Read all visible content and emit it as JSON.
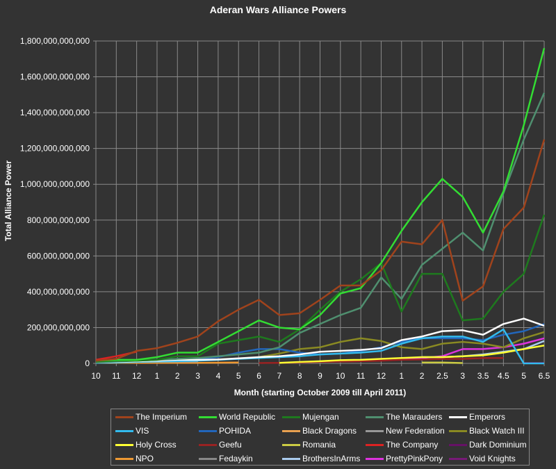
{
  "chart_data": {
    "type": "line",
    "title": "Aderan Wars Alliance Powers",
    "xlabel": "Month (starting October 2009 till April 2011)",
    "ylabel": "Total Alliance Power",
    "ylim": [
      0,
      1800000000000
    ],
    "yticks": [
      0,
      200000000000,
      400000000000,
      600000000000,
      800000000000,
      1000000000000,
      1200000000000,
      1400000000000,
      1600000000000,
      1800000000000
    ],
    "ytick_labels": [
      "0",
      "200,000,000,000",
      "400,000,000,000",
      "600,000,000,000",
      "800,000,000,000",
      "1,000,000,000,000",
      "1,200,000,000,000",
      "1,400,000,000,000",
      "1,600,000,000,000",
      "1,800,000,000,000"
    ],
    "categories": [
      "10",
      "11",
      "12",
      "1",
      "2",
      "3",
      "4",
      "5",
      "6",
      "7",
      "8",
      "9",
      "10",
      "11",
      "12",
      "1",
      "2",
      "2.5",
      "3",
      "3.5",
      "4.5",
      "5",
      "6.5"
    ],
    "grid": true,
    "legend_position": "bottom",
    "series": [
      {
        "name": "The Imperium",
        "color": "#a0431c",
        "values": [
          15000000000,
          25000000000,
          70000000000,
          85000000000,
          115000000000,
          150000000000,
          235000000000,
          300000000000,
          355000000000,
          270000000000,
          280000000000,
          355000000000,
          435000000000,
          435000000000,
          520000000000,
          680000000000,
          665000000000,
          800000000000,
          350000000000,
          430000000000,
          750000000000,
          870000000000,
          1250000000000
        ]
      },
      {
        "name": "World Republic",
        "color": "#33dd33",
        "values": [
          15000000000,
          20000000000,
          20000000000,
          35000000000,
          60000000000,
          60000000000,
          120000000000,
          180000000000,
          240000000000,
          200000000000,
          190000000000,
          270000000000,
          390000000000,
          420000000000,
          560000000000,
          740000000000,
          900000000000,
          1030000000000,
          930000000000,
          730000000000,
          960000000000,
          1330000000000,
          1760000000000
        ]
      },
      {
        "name": "Mujengan",
        "color": "#1e7a1e",
        "values": [
          10000000000,
          15000000000,
          15000000000,
          20000000000,
          40000000000,
          40000000000,
          110000000000,
          130000000000,
          150000000000,
          120000000000,
          190000000000,
          300000000000,
          400000000000,
          470000000000,
          560000000000,
          290000000000,
          500000000000,
          500000000000,
          240000000000,
          250000000000,
          400000000000,
          500000000000,
          830000000000
        ]
      },
      {
        "name": "The Marauders",
        "color": "#4f8f6f",
        "values": [
          5000000000,
          10000000000,
          15000000000,
          20000000000,
          25000000000,
          30000000000,
          40000000000,
          50000000000,
          60000000000,
          90000000000,
          170000000000,
          220000000000,
          270000000000,
          310000000000,
          480000000000,
          360000000000,
          550000000000,
          640000000000,
          730000000000,
          630000000000,
          950000000000,
          1250000000000,
          1510000000000
        ]
      },
      {
        "name": "Emperors",
        "color": "#ffffff",
        "values": [
          5000000000,
          8000000000,
          12000000000,
          15000000000,
          20000000000,
          20000000000,
          22000000000,
          28000000000,
          35000000000,
          40000000000,
          50000000000,
          65000000000,
          70000000000,
          75000000000,
          85000000000,
          130000000000,
          150000000000,
          180000000000,
          185000000000,
          160000000000,
          220000000000,
          250000000000,
          210000000000
        ]
      },
      {
        "name": "VIS",
        "color": "#33bbee",
        "values": [
          3000000000,
          5000000000,
          8000000000,
          10000000000,
          12000000000,
          15000000000,
          20000000000,
          25000000000,
          30000000000,
          35000000000,
          40000000000,
          50000000000,
          55000000000,
          60000000000,
          70000000000,
          110000000000,
          140000000000,
          150000000000,
          150000000000,
          120000000000,
          190000000000,
          0,
          0
        ]
      },
      {
        "name": "POHIDA",
        "color": "#2266bb",
        "values": [
          3000000000,
          8000000000,
          15000000000,
          20000000000,
          25000000000,
          25000000000,
          35000000000,
          60000000000,
          80000000000,
          80000000000,
          60000000000,
          50000000000,
          55000000000,
          70000000000,
          90000000000,
          120000000000,
          140000000000,
          140000000000,
          140000000000,
          130000000000,
          160000000000,
          180000000000,
          220000000000
        ]
      },
      {
        "name": "Black Dragons",
        "color": "#e8a050",
        "values": [
          null,
          null,
          null,
          null,
          null,
          null,
          null,
          null,
          null,
          null,
          null,
          null,
          null,
          null,
          null,
          null,
          null,
          null,
          null,
          null,
          null,
          null,
          null
        ]
      },
      {
        "name": "New Federation",
        "color": "#999999",
        "values": [
          8000000000,
          10000000000,
          10000000000,
          10000000000,
          10000000000,
          10000000000,
          null,
          null,
          null,
          null,
          null,
          null,
          null,
          null,
          null,
          null,
          null,
          null,
          null,
          null,
          null,
          null,
          null
        ]
      },
      {
        "name": "Black Watch III",
        "color": "#8a8a22",
        "values": [
          null,
          null,
          null,
          null,
          null,
          null,
          null,
          null,
          35000000000,
          55000000000,
          80000000000,
          90000000000,
          120000000000,
          140000000000,
          125000000000,
          90000000000,
          80000000000,
          110000000000,
          120000000000,
          110000000000,
          90000000000,
          140000000000,
          175000000000
        ]
      },
      {
        "name": "Holy Cross",
        "color": "#ffff33",
        "values": [
          null,
          null,
          null,
          null,
          null,
          null,
          null,
          null,
          null,
          3000000000,
          8000000000,
          12000000000,
          18000000000,
          20000000000,
          25000000000,
          30000000000,
          35000000000,
          35000000000,
          40000000000,
          45000000000,
          60000000000,
          80000000000,
          100000000000
        ]
      },
      {
        "name": "Geefu",
        "color": "#992222",
        "values": [
          null,
          null,
          null,
          null,
          null,
          null,
          null,
          null,
          2000000000,
          3000000000,
          5000000000,
          8000000000,
          10000000000,
          12000000000,
          15000000000,
          20000000000,
          22000000000,
          25000000000,
          25000000000,
          30000000000,
          30000000000,
          null,
          null
        ]
      },
      {
        "name": "Romania",
        "color": "#cccc44",
        "values": [
          null,
          null,
          null,
          null,
          null,
          null,
          null,
          null,
          null,
          null,
          null,
          null,
          null,
          null,
          null,
          null,
          5000000000,
          5000000000,
          2000000000,
          null,
          null,
          null,
          null
        ]
      },
      {
        "name": "The Company",
        "color": "#dd2222",
        "values": [
          20000000000,
          40000000000,
          65000000000,
          null,
          null,
          null,
          null,
          null,
          null,
          null,
          null,
          null,
          null,
          null,
          null,
          null,
          null,
          null,
          null,
          null,
          null,
          null,
          null
        ]
      },
      {
        "name": "Dark Dominium",
        "color": "#661166",
        "values": [
          null,
          null,
          null,
          null,
          null,
          null,
          null,
          null,
          null,
          null,
          null,
          null,
          null,
          null,
          null,
          null,
          null,
          null,
          null,
          null,
          null,
          null,
          null
        ]
      },
      {
        "name": "NPO",
        "color": "#ee9933",
        "values": [
          3000000000,
          3000000000,
          3000000000,
          3000000000,
          3000000000,
          3000000000,
          4000000000,
          5000000000,
          null,
          null,
          null,
          null,
          null,
          null,
          null,
          null,
          null,
          null,
          null,
          null,
          null,
          null,
          null
        ]
      },
      {
        "name": "Fedaykin",
        "color": "#888888",
        "values": [
          null,
          null,
          null,
          null,
          null,
          null,
          null,
          null,
          null,
          null,
          null,
          null,
          null,
          null,
          null,
          null,
          null,
          null,
          null,
          null,
          null,
          null,
          null
        ]
      },
      {
        "name": "BrothersInArms",
        "color": "#aaccee",
        "values": [
          null,
          null,
          null,
          null,
          null,
          null,
          null,
          null,
          null,
          null,
          null,
          null,
          null,
          null,
          null,
          null,
          35000000000,
          35000000000,
          40000000000,
          50000000000,
          65000000000,
          80000000000,
          125000000000
        ]
      },
      {
        "name": "PrettyPinkPony",
        "color": "#dd33dd",
        "values": [
          null,
          null,
          null,
          null,
          null,
          null,
          null,
          null,
          null,
          null,
          null,
          null,
          null,
          null,
          null,
          30000000000,
          30000000000,
          40000000000,
          80000000000,
          80000000000,
          90000000000,
          110000000000,
          140000000000
        ]
      },
      {
        "name": "Void Knights",
        "color": "#771a77",
        "values": [
          null,
          null,
          null,
          null,
          null,
          null,
          null,
          null,
          null,
          null,
          null,
          null,
          null,
          null,
          null,
          null,
          null,
          null,
          null,
          null,
          null,
          2000000000,
          2000000000
        ]
      }
    ]
  }
}
